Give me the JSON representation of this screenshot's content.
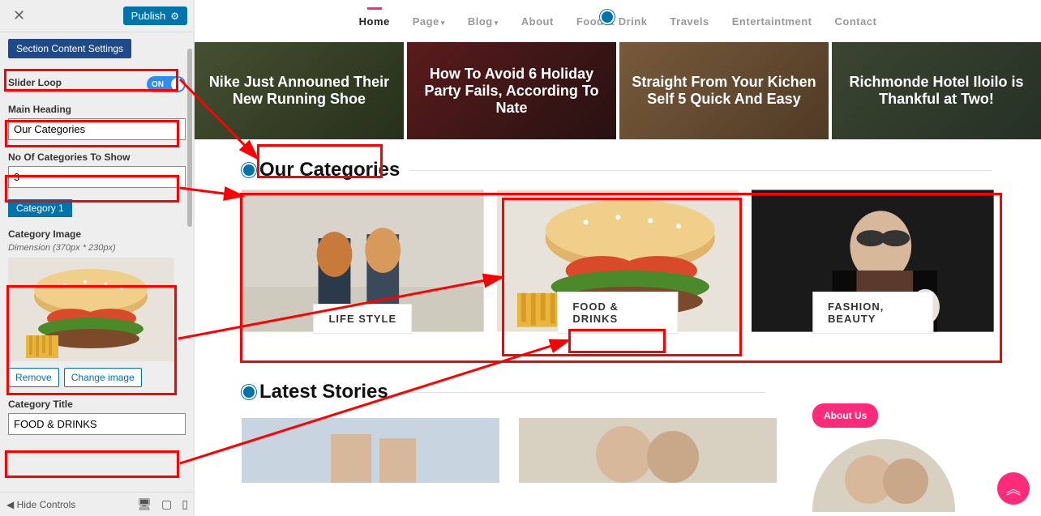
{
  "sidebar": {
    "publish_label": "Publish",
    "section_content_label": "Section Content Settings",
    "slider_loop": {
      "label": "Slider Loop",
      "state": "ON"
    },
    "main_heading": {
      "label": "Main Heading",
      "value": "Our Categories"
    },
    "no_categories": {
      "label": "No Of Categories To Show",
      "value": "3"
    },
    "category1_label": "Category 1",
    "category_image": {
      "label": "Category Image",
      "dimension_note": "Dimension (370px * 230px)"
    },
    "remove_label": "Remove",
    "change_image_label": "Change image",
    "category_title": {
      "label": "Category Title",
      "value": "FOOD & DRINKS"
    },
    "footer": {
      "hide_controls": "Hide Controls"
    }
  },
  "nav": {
    "items": [
      "Home",
      "Page",
      "Blog",
      "About",
      "Food & Drink",
      "Travels",
      "Entertaintment",
      "Contact"
    ],
    "active_index": 0
  },
  "hero": {
    "cards": [
      {
        "title": "Nike Just Announed Their New Running Shoe"
      },
      {
        "title": "How To Avoid 6 Holiday Party Fails, According To Nate"
      },
      {
        "title": "Straight From Your Kichen Self 5 Quick And Easy"
      },
      {
        "title": "Richmonde Hotel Iloilo is Thankful at Two!"
      }
    ]
  },
  "sections": {
    "our_categories_heading": "Our Categories",
    "latest_stories_heading": "Latest Stories"
  },
  "categories": {
    "items": [
      {
        "label": "LIFE STYLE"
      },
      {
        "label": "FOOD & DRINKS"
      },
      {
        "label": "FASHION, BEAUTY"
      }
    ]
  },
  "about": {
    "label": "About Us"
  }
}
